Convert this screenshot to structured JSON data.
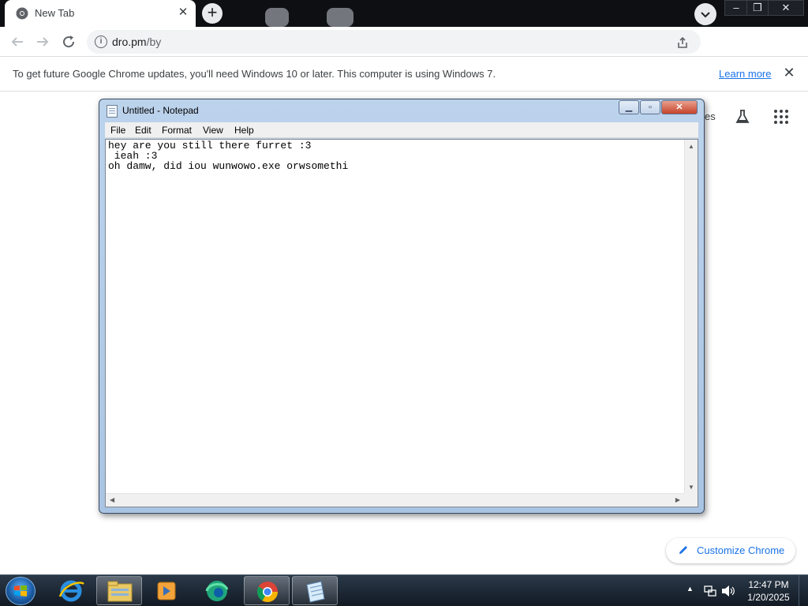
{
  "browser": {
    "tab": {
      "title": "New Tab",
      "close_glyph": "✕"
    },
    "new_tab_glyph": "+",
    "window_controls": {
      "minimize": "–",
      "restore": "❐",
      "close": "✕"
    },
    "url_host": "dro.pm",
    "url_path": "/by",
    "infobar": {
      "message": "To get future Google Chrome updates, you'll need Windows 10 or later. This computer is using Windows 7.",
      "link": "Learn more",
      "close_glyph": "✕"
    }
  },
  "ntp": {
    "partial_text": "es",
    "customize_label": "Customize Chrome"
  },
  "notepad": {
    "title": "Untitled - Notepad",
    "menu": [
      "File",
      "Edit",
      "Format",
      "View",
      "Help"
    ],
    "text": "hey are you still there furret :3\n ieah :3\noh damw, did iou wunwowo.exe orwsomethi"
  },
  "taskbar": {
    "time": "12:47 PM",
    "date": "1/20/2025",
    "apps": [
      "internet-explorer",
      "file-explorer",
      "media-player",
      "edge",
      "chrome",
      "notepad"
    ]
  },
  "colors": {
    "chrome_dark": "#0d0f12",
    "link_blue": "#1a73e8",
    "taskbar": "#1b2533"
  }
}
